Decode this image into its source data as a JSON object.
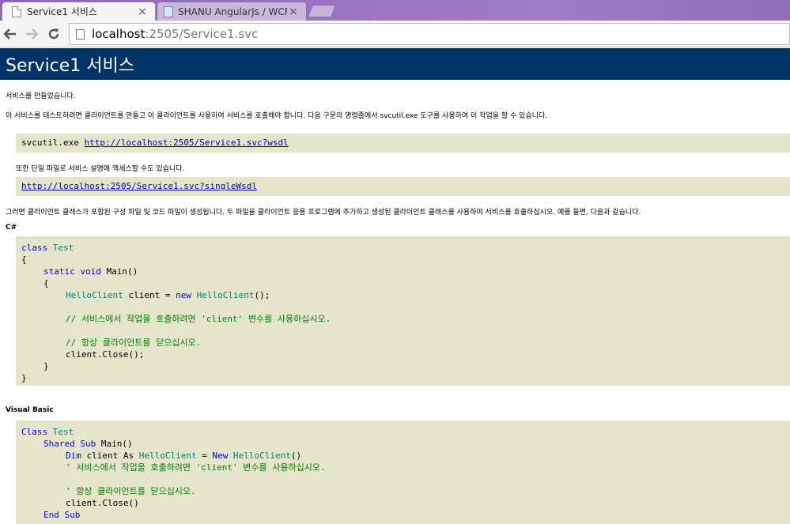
{
  "browser": {
    "tabs": [
      {
        "title": "Service1 서비스",
        "active": true,
        "close": "×"
      },
      {
        "title": "SHANU AngularJs / WCF",
        "active": false,
        "close": "×"
      }
    ],
    "address": {
      "host": "localhost",
      "path": ":2505/Service1.svc"
    }
  },
  "page": {
    "title": "Service1 서비스",
    "created_text": "서비스를 만들었습니다.",
    "test_instructions": "이 서비스를 테스트하려면 클라이언트를 만들고 이 클라이언트를 사용하여 서비스를 호출해야 합니다. 다음 구문의 명령줄에서 svcutil.exe 도구를 사용하여 이 작업을 할 수 있습니다.",
    "svcutil_cmd": "svcutil.exe ",
    "wsdl_link": "http://localhost:2505/Service1.svc?wsdl",
    "single_file_text": "또한 단일 파일로 서비스 설명에 액세스할 수도 있습니다.",
    "single_wsdl_link": "http://localhost:2505/Service1.svc?singleWsdl",
    "generated_text": "그러면 클라이언트 클래스가 포함된 구성 파일 및 코드 파일이 생성됩니다. 두 파일을 클라이언트 응용 프로그램에 추가하고 생성된 클라이언트 클래스를 사용하여 서비스를 호출하십시오. 예를 들면, 다음과 같습니다.",
    "csharp_label": "C#",
    "vb_label": "Visual Basic"
  },
  "csharp_code": {
    "l1_kw": "class",
    "l1_type": "Test",
    "l2": "{",
    "l3_kw": "static void",
    "l3_rest": " Main()",
    "l4": "{",
    "l5_type": "HelloClient",
    "l5_mid": " client = ",
    "l5_kw": "new",
    "l5_type2": "HelloClient",
    "l5_end": "();",
    "l6_comment": "// 서비스에서 작업을 호출하려면 'client' 변수를 사용하십시오.",
    "l7_comment": "// 항상 클라이언트를 닫으십시오.",
    "l8": "client.Close();",
    "l9": "}",
    "l10": "}"
  },
  "vb_code": {
    "l1_kw": "Class",
    "l1_type": "Test",
    "l2_kw": "Shared Sub",
    "l2_rest": " Main()",
    "l3_kw": "Dim",
    "l3_mid": " client As ",
    "l3_type": "HelloClient",
    "l3_eq": " = ",
    "l3_kw2": "New",
    "l3_type2": "HelloClient",
    "l3_end": "()",
    "l4_comment": "' 서비스에서 작업을 호출하려면 'client' 변수를 사용하십시오.",
    "l5_comment": "' 항상 클라이언트를 닫으십시오.",
    "l6": "client.Close()",
    "l7_kw": "End Sub"
  },
  "colors": {
    "heading_band": "#003366",
    "code_box": "#e5e5cc",
    "keyword": "#0000ff",
    "type": "#008080",
    "comment": "#008000",
    "link": "#0000cc"
  },
  "icons": [
    "page-icon",
    "close-icon",
    "back-arrow-icon",
    "forward-arrow-icon",
    "reload-icon",
    "new-tab-icon"
  ]
}
